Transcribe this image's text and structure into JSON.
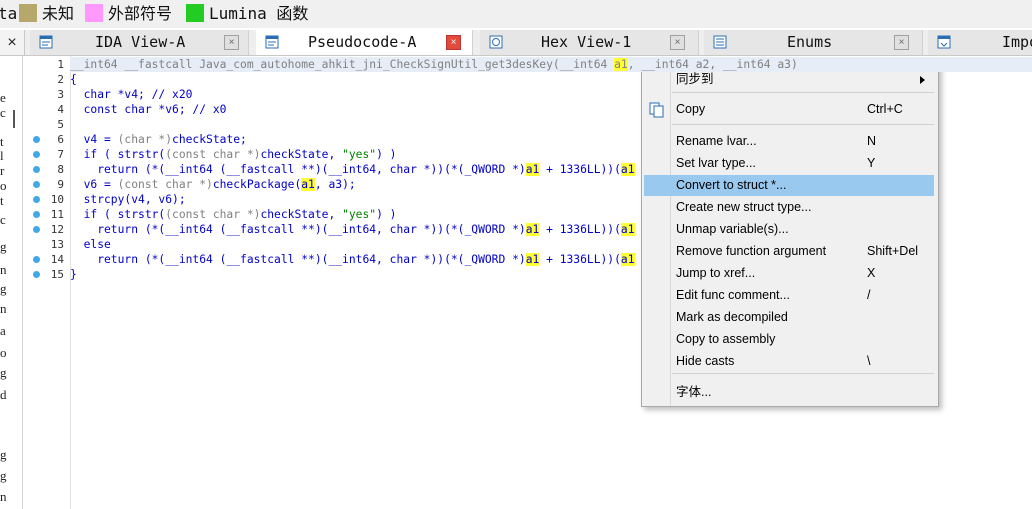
{
  "legend": {
    "cut_text": "ta",
    "items": [
      {
        "label": "未知",
        "color": "#b5a86a"
      },
      {
        "label": "外部符号",
        "color": "#ff99ff"
      },
      {
        "label": "Lumina 函数",
        "color": "#22cc22"
      }
    ]
  },
  "tabs": [
    {
      "label": "IDA View-A",
      "icon": "ida-view-icon",
      "active": false
    },
    {
      "label": "Pseudocode-A",
      "icon": "pseudocode-icon",
      "active": true
    },
    {
      "label": "Hex View-1",
      "icon": "hex-view-icon",
      "active": false
    },
    {
      "label": "Enums",
      "icon": "enums-icon",
      "active": false
    },
    {
      "label": "Impo",
      "icon": "imports-icon",
      "active": false
    }
  ],
  "close_glyph": "×",
  "left_panel_chars": [
    "e",
    "c",
    "t",
    "l",
    "r",
    "o",
    "t",
    "c",
    "g",
    "n",
    "g",
    "n",
    "a",
    "o",
    "g",
    "d",
    "g",
    "g",
    "n"
  ],
  "code": {
    "lines": [
      {
        "n": "1",
        "bp": false
      },
      {
        "n": "2",
        "bp": false
      },
      {
        "n": "3",
        "bp": false
      },
      {
        "n": "4",
        "bp": false
      },
      {
        "n": "5",
        "bp": false
      },
      {
        "n": "6",
        "bp": true
      },
      {
        "n": "7",
        "bp": true
      },
      {
        "n": "8",
        "bp": true
      },
      {
        "n": "9",
        "bp": true
      },
      {
        "n": "10",
        "bp": true
      },
      {
        "n": "11",
        "bp": true
      },
      {
        "n": "12",
        "bp": true
      },
      {
        "n": "13",
        "bp": false
      },
      {
        "n": "14",
        "bp": true
      },
      {
        "n": "15",
        "bp": true
      }
    ],
    "l1": "__int64 __fastcall Java_com_autohome_ahkit_jni_CheckSignUtil_get3desKey(__int64 ",
    "l1_hl": "a1",
    "l1_tail": ", __int64 a2, __int64 a3)",
    "open_brace": "{",
    "close_brace": "}",
    "l3": "  char *v4; // x20",
    "l4": "  const char *v6; // x0",
    "l6_a": "  v4 = ",
    "l6_b": "(char *)",
    "l6_c": "checkState;",
    "if_a": "  if ( strstr(",
    "if_b": "(const char *)",
    "if_c": "checkState, ",
    "if_s": "\"yes\"",
    "if_d": ") )",
    "ret_a": "    return (*(__int64 (__fastcall **)(__int64, char *))(*(_QWORD *)",
    "ret_hl": "a1",
    "ret_b": " + 1336LL))(",
    "ret_hl2": "a1",
    "l9_a": "  v6 = ",
    "l9_b": "(const char *)",
    "l9_c": "checkPackage(",
    "l9_hl": "a1",
    "l9_d": ", a3);",
    "l10": "  strcpy(v4, v6);",
    "l13": "  else"
  },
  "menu": {
    "items": [
      {
        "label": "同步到",
        "shortcut": "",
        "submenu": true
      },
      {
        "label": "Copy",
        "shortcut": "Ctrl+C"
      },
      {
        "label": "Rename lvar...",
        "shortcut": "N"
      },
      {
        "label": "Set lvar type...",
        "shortcut": "Y"
      },
      {
        "label": "Convert to struct *...",
        "shortcut": "",
        "selected": true
      },
      {
        "label": "Create new struct type...",
        "shortcut": ""
      },
      {
        "label": "Unmap variable(s)...",
        "shortcut": ""
      },
      {
        "label": "Remove function argument",
        "shortcut": "Shift+Del"
      },
      {
        "label": "Jump to xref...",
        "shortcut": "X"
      },
      {
        "label": "Edit func comment...",
        "shortcut": "/"
      },
      {
        "label": "Mark as decompiled",
        "shortcut": ""
      },
      {
        "label": "Copy to assembly",
        "shortcut": ""
      },
      {
        "label": "Hide casts",
        "shortcut": "\\"
      },
      {
        "label": "字体...",
        "shortcut": ""
      }
    ]
  }
}
